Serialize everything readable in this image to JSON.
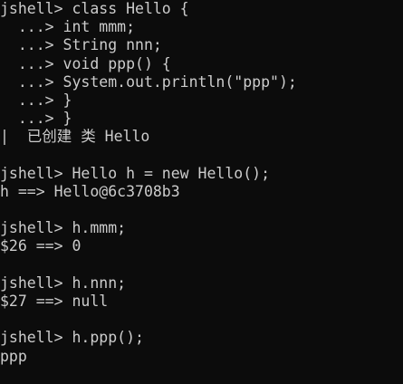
{
  "terminal": {
    "lines": [
      {
        "id": "l01",
        "text": "jshell> class Hello {",
        "kind": "input"
      },
      {
        "id": "l02",
        "text": "  ...> int mmm;",
        "kind": "continuation"
      },
      {
        "id": "l03",
        "text": "  ...> String nnn;",
        "kind": "continuation"
      },
      {
        "id": "l04",
        "text": "  ...> void ppp() {",
        "kind": "continuation"
      },
      {
        "id": "l05",
        "text": "  ...> System.out.println(\"ppp\");",
        "kind": "continuation"
      },
      {
        "id": "l06",
        "text": "  ...> }",
        "kind": "continuation"
      },
      {
        "id": "l07",
        "text": "  ...> }",
        "kind": "continuation"
      },
      {
        "id": "l08",
        "text": "|  已创建 类 Hello",
        "kind": "feedback"
      },
      {
        "id": "l09",
        "text": "",
        "kind": "blank"
      },
      {
        "id": "l10",
        "text": "jshell> Hello h = new Hello();",
        "kind": "input"
      },
      {
        "id": "l11",
        "text": "h ==> Hello@6c3708b3",
        "kind": "output"
      },
      {
        "id": "l12",
        "text": "",
        "kind": "blank"
      },
      {
        "id": "l13",
        "text": "jshell> h.mmm;",
        "kind": "input"
      },
      {
        "id": "l14",
        "text": "$26 ==> 0",
        "kind": "output"
      },
      {
        "id": "l15",
        "text": "",
        "kind": "blank"
      },
      {
        "id": "l16",
        "text": "jshell> h.nnn;",
        "kind": "input"
      },
      {
        "id": "l17",
        "text": "$27 ==> null",
        "kind": "output"
      },
      {
        "id": "l18",
        "text": "",
        "kind": "blank"
      },
      {
        "id": "l19",
        "text": "jshell> h.ppp();",
        "kind": "input"
      },
      {
        "id": "l20",
        "text": "ppp",
        "kind": "output"
      }
    ]
  },
  "colors": {
    "background": "#0c0c0c",
    "foreground": "#cccccc"
  }
}
